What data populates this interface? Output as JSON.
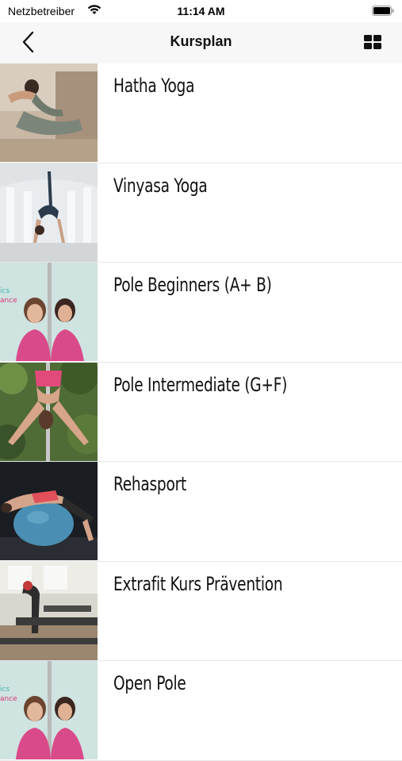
{
  "status": {
    "carrier": "Netzbetreiber",
    "time": "11:14 AM",
    "icons": [
      "wifi-icon",
      "battery-icon"
    ]
  },
  "nav": {
    "title": "Kursplan",
    "back_icon": "chevron-left-icon",
    "view_icon": "grid-view-icon",
    "accent": "#111111"
  },
  "courses": [
    {
      "label": "Hatha Yoga",
      "image": "yoga-pose-photo"
    },
    {
      "label": "Vinyasa Yoga",
      "image": "yoga-arch-photo"
    },
    {
      "label": "Pole Beginners  (A+ B)",
      "image": "pole-duo-photo"
    },
    {
      "label": "Pole Intermediate (G+F)",
      "image": "pole-outdoor-photo"
    },
    {
      "label": "Rehasport",
      "image": "exercise-ball-photo"
    },
    {
      "label": "Extrafit Kurs Prävention",
      "image": "pilates-studio-photo"
    },
    {
      "label": "Open Pole",
      "image": "pole-duo-photo"
    }
  ]
}
